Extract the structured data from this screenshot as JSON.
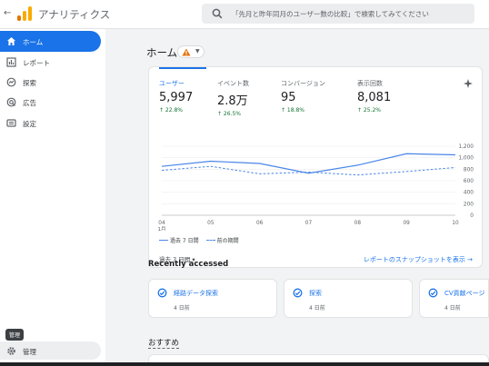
{
  "header": {
    "back_icon": "back-arrow-icon",
    "app_title": "アナリティクス",
    "search_placeholder": "「先月と昨年同月のユーザー数の比較」で検索してみてください"
  },
  "sidebar": {
    "items": [
      {
        "label": "ホーム",
        "icon": "home-icon",
        "active": true
      },
      {
        "label": "レポート",
        "icon": "reports-icon",
        "active": false
      },
      {
        "label": "探索",
        "icon": "explore-icon",
        "active": false
      },
      {
        "label": "広告",
        "icon": "advertising-icon",
        "active": false
      },
      {
        "label": "設定",
        "icon": "configure-icon",
        "active": false
      }
    ],
    "tooltip": "管理",
    "admin_label": "管理"
  },
  "main": {
    "title": "ホーム",
    "metrics": [
      {
        "label": "ユーザー",
        "value": "5,997",
        "delta": "↑ 22.8%"
      },
      {
        "label": "イベント数",
        "value": "2.8万",
        "delta": "↑ 26.5%"
      },
      {
        "label": "コンバージョン",
        "value": "95",
        "delta": "↑ 18.8%"
      },
      {
        "label": "表示回数",
        "value": "8,081",
        "delta": "↑ 25.2%"
      }
    ],
    "legend": {
      "current": "過去 7 日間",
      "previous": "前の期間"
    },
    "period_selector": "過去 7 日間 ▾",
    "snapshot_link": "レポートのスナップショットを表示 →",
    "recent_title": "Recently accessed",
    "recent": [
      {
        "name": "経路データ探索",
        "sub": "4 日前"
      },
      {
        "name": "探索",
        "sub": "4 日前"
      },
      {
        "name": "CV貢献ページ",
        "sub": "4 日前"
      }
    ],
    "recommend_title": "おすすめ"
  },
  "chart_data": {
    "type": "line",
    "x": [
      "04",
      "05",
      "06",
      "07",
      "08",
      "09",
      "10"
    ],
    "x_sub": "1月",
    "ylim": [
      0,
      1200
    ],
    "yticks": [
      "1,200",
      "1,000",
      "800",
      "600",
      "400",
      "200",
      "0"
    ],
    "series": [
      {
        "name": "過去 7 日間",
        "style": "solid",
        "values": [
          850,
          940,
          900,
          730,
          870,
          1070,
          1050
        ]
      },
      {
        "name": "前の期間",
        "style": "dashed",
        "values": [
          780,
          850,
          720,
          750,
          700,
          760,
          830
        ]
      }
    ],
    "color": "#4a86e8"
  }
}
